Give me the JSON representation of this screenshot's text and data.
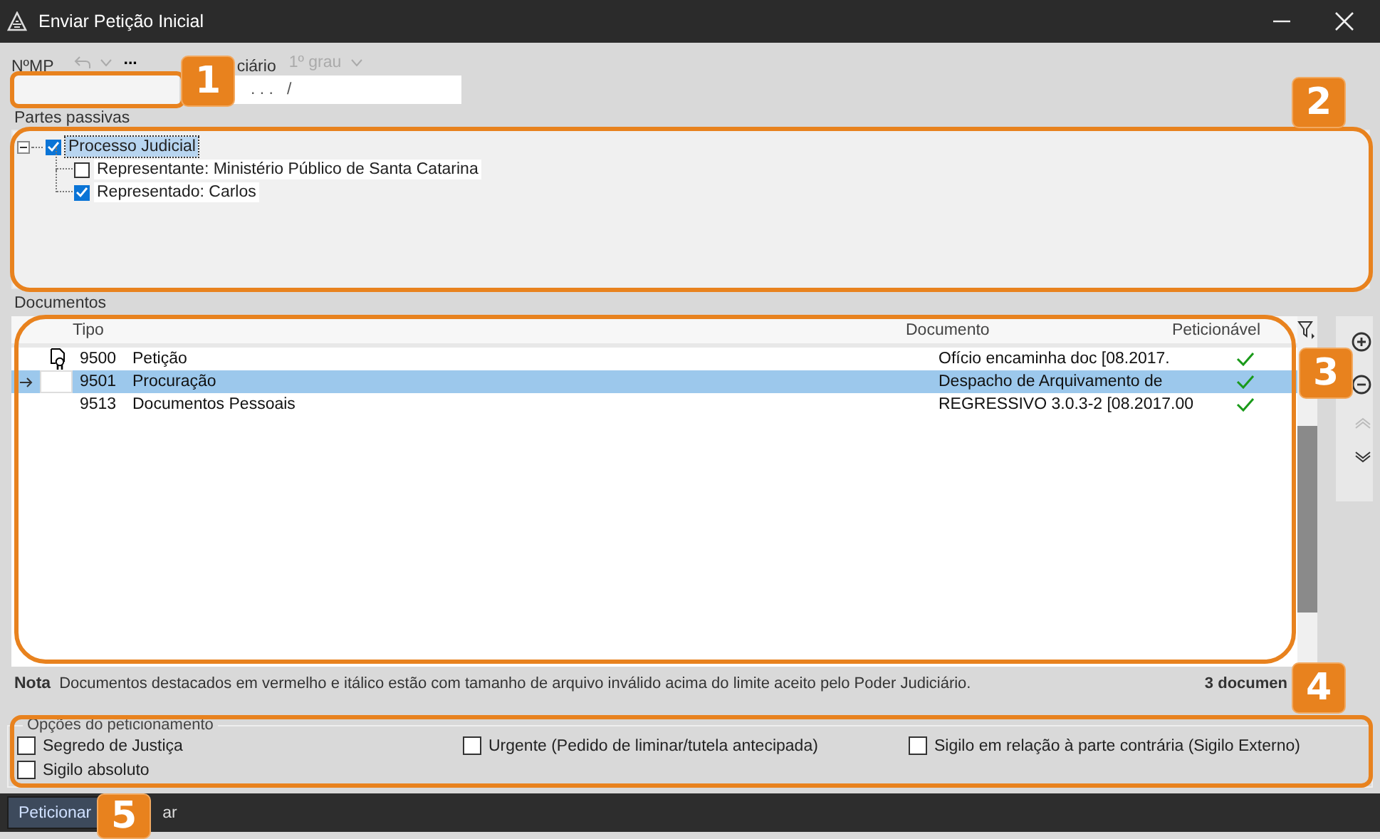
{
  "window": {
    "title": "Enviar Petição Inicial"
  },
  "header": {
    "mp_label": "NºMP",
    "more": "...",
    "court_label": "ciário",
    "instance": "1º grau",
    "process_field": {
      "value": ". . .   /"
    }
  },
  "partes_passivas": {
    "title": "Partes passivas",
    "tree": [
      {
        "label": "Processo Judicial",
        "checked": true,
        "selected": true,
        "expanded": true,
        "children": [
          {
            "label": "Representante: Ministério Público de Santa Catarina",
            "checked": false,
            "selected": false
          },
          {
            "label": "Representado: Carlos",
            "checked": true,
            "selected": false
          }
        ]
      }
    ]
  },
  "documentos": {
    "title": "Documentos",
    "columns": [
      "Tipo",
      "Documento",
      "Peticionável"
    ],
    "rows": [
      {
        "code": "9500",
        "tipo": "Petição",
        "documento": "Ofício encaminha doc [08.2017.",
        "peticionavel": true,
        "signed": true,
        "current": false,
        "selected": false
      },
      {
        "code": "9501",
        "tipo": "Procuração",
        "documento": "Despacho de Arquivamento de",
        "peticionavel": true,
        "signed": false,
        "current": true,
        "selected": true
      },
      {
        "code": "9513",
        "tipo": "Documentos Pessoais",
        "documento": "REGRESSIVO 3.0.3-2 [08.2017.00",
        "peticionavel": true,
        "signed": false,
        "current": false,
        "selected": false
      }
    ],
    "note_label": "Nota",
    "note": "Documentos destacados em vermelho e itálico estão com tamanho de arquivo inválido acima do limite aceito pelo Poder Judiciário.",
    "count": "3 documen"
  },
  "opcoes": {
    "title": "Opções do peticionamento",
    "items": [
      {
        "label": "Segredo de Justiça",
        "checked": false
      },
      {
        "label": "Urgente (Pedido de liminar/tutela antecipada)",
        "checked": false
      },
      {
        "label": "Sigilo em relação à parte contrária (Sigilo Externo)",
        "checked": false
      },
      {
        "label": "Sigilo absoluto",
        "checked": false
      }
    ]
  },
  "buttons": [
    {
      "label": "Peticionar",
      "focused": true
    },
    {
      "label": "ar",
      "focused": false
    }
  ],
  "callouts": [
    "1",
    "2",
    "3",
    "4",
    "5"
  ]
}
